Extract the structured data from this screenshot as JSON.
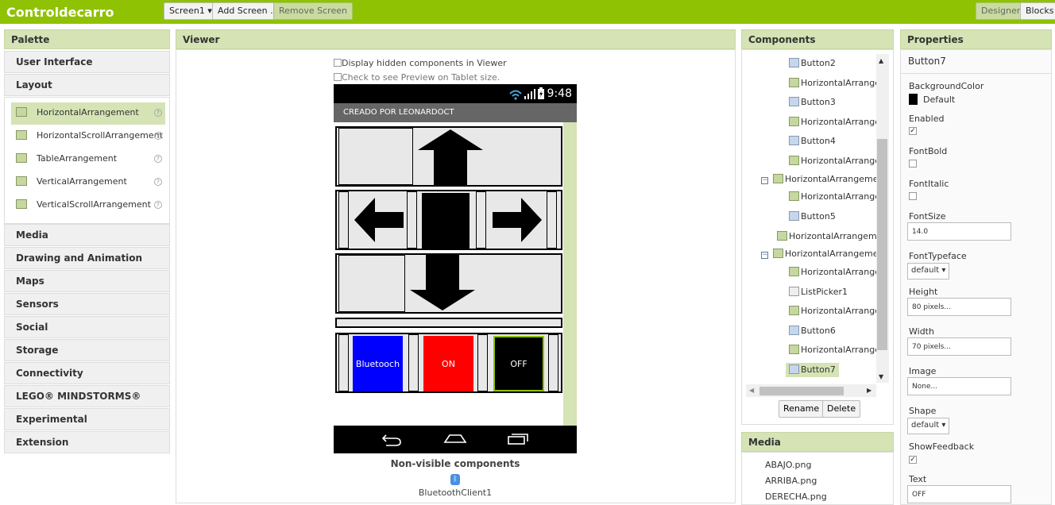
{
  "app": {
    "title": "Controldecarro",
    "screen_select": "Screen1 ▾",
    "add_screen": "Add Screen ...",
    "remove_screen": "Remove Screen",
    "designer": "Designer",
    "blocks": "Blocks"
  },
  "palette": {
    "title": "Palette",
    "categories_top": [
      "User Interface",
      "Layout"
    ],
    "layout_items": [
      "HorizontalArrangement",
      "HorizontalScrollArrangement",
      "TableArrangement",
      "VerticalArrangement",
      "VerticalScrollArrangement"
    ],
    "selected_item": "HorizontalArrangement",
    "categories_bottom": [
      "Media",
      "Drawing and Animation",
      "Maps",
      "Sensors",
      "Social",
      "Storage",
      "Connectivity",
      "LEGO® MINDSTORMS®",
      "Experimental",
      "Extension"
    ]
  },
  "viewer": {
    "title": "Viewer",
    "check_hidden": "Display hidden components in Viewer",
    "check_tablet": "Check to see Preview on Tablet size.",
    "status_time": "9:48",
    "screen_title": "CREADO POR LEONARDOCT",
    "buttons": {
      "bluetooth": "Bluetooch",
      "on": "ON",
      "off": "OFF"
    },
    "colors": {
      "bluetooth": "#0000ff",
      "on": "#ff0000",
      "off": "#000000"
    },
    "nonvisible_title": "Non-visible components",
    "nonvisible_item": "BluetoothClient1"
  },
  "components": {
    "title": "Components",
    "tree": [
      {
        "label": "Button2",
        "icon": "button"
      },
      {
        "label": "HorizontalArranger",
        "icon": "arrangement"
      },
      {
        "label": "Button3",
        "icon": "button"
      },
      {
        "label": "HorizontalArranger",
        "icon": "arrangement"
      },
      {
        "label": "Button4",
        "icon": "button"
      },
      {
        "label": "HorizontalArranger",
        "icon": "arrangement"
      },
      {
        "label": "HorizontalArrangemer",
        "icon": "arrangement",
        "collapsible": true
      },
      {
        "label": "HorizontalArranger",
        "icon": "arrangement"
      },
      {
        "label": "Button5",
        "icon": "button"
      },
      {
        "label": "HorizontalArrangemer",
        "icon": "arrangement"
      },
      {
        "label": "HorizontalArrangemer",
        "icon": "arrangement",
        "collapsible": true
      },
      {
        "label": "HorizontalArranger",
        "icon": "arrangement"
      },
      {
        "label": "ListPicker1",
        "icon": "listpicker"
      },
      {
        "label": "HorizontalArranger",
        "icon": "arrangement"
      },
      {
        "label": "Button6",
        "icon": "button"
      },
      {
        "label": "HorizontalArranger",
        "icon": "arrangement"
      },
      {
        "label": "Button7",
        "icon": "button",
        "selected": true
      }
    ],
    "rename": "Rename",
    "delete": "Delete"
  },
  "media": {
    "title": "Media",
    "files": [
      "ABAJO.png",
      "ARRIBA.png",
      "DERECHA.png"
    ]
  },
  "properties": {
    "title": "Properties",
    "component": "Button7",
    "background_color_label": "BackgroundColor",
    "background_color_value": "Default",
    "enabled_label": "Enabled",
    "enabled": true,
    "fontbold_label": "FontBold",
    "fontbold": false,
    "fontitalic_label": "FontItalic",
    "fontitalic": false,
    "fontsize_label": "FontSize",
    "fontsize": "14.0",
    "fonttypeface_label": "FontTypeface",
    "fonttypeface": "default ▾",
    "height_label": "Height",
    "height": "80 pixels...",
    "width_label": "Width",
    "width": "70 pixels...",
    "image_label": "Image",
    "image": "None...",
    "shape_label": "Shape",
    "shape": "default ▾",
    "showfeedback_label": "ShowFeedback",
    "showfeedback": true,
    "text_label": "Text",
    "text": "OFF"
  }
}
